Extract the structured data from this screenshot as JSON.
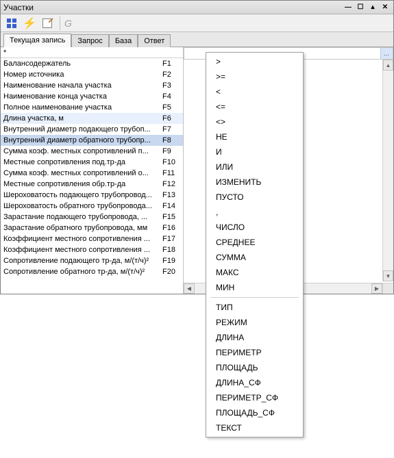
{
  "window": {
    "title": "Участки"
  },
  "toolbar": {
    "g_label": "G"
  },
  "tabs": {
    "items": [
      {
        "label": "Текущая запись"
      },
      {
        "label": "Запрос"
      },
      {
        "label": "База"
      },
      {
        "label": "Ответ"
      }
    ]
  },
  "left_header": {
    "star": "*"
  },
  "fields": [
    {
      "name": "Балансодержатель",
      "fld": "F1"
    },
    {
      "name": "Номер источника",
      "fld": "F2"
    },
    {
      "name": "Наименование начала участка",
      "fld": "F3"
    },
    {
      "name": "Наименование конца участка",
      "fld": "F4"
    },
    {
      "name": "Полное наименование участка",
      "fld": "F5"
    },
    {
      "name": "Длина участка, м",
      "fld": "F6"
    },
    {
      "name": "Внутренний диаметр подающего трубоп...",
      "fld": "F7"
    },
    {
      "name": "Внутренний диаметр обратного трубопр...",
      "fld": "F8"
    },
    {
      "name": "Сумма коэф. местных сопротивлений п...",
      "fld": "F9"
    },
    {
      "name": "Местные сопротивления под.тр-да",
      "fld": "F10"
    },
    {
      "name": "Сумма коэф. местных сопротивлений о...",
      "fld": "F11"
    },
    {
      "name": "Местные сопротивления обр.тр-да",
      "fld": "F12"
    },
    {
      "name": "Шероховатость подающего трубопровод...",
      "fld": "F13"
    },
    {
      "name": "Шероховатость обратного трубопровода...",
      "fld": "F14"
    },
    {
      "name": "Зарастание подающего трубопровода, ...",
      "fld": "F15"
    },
    {
      "name": "Зарастание обратного трубопровода, мм",
      "fld": "F16"
    },
    {
      "name": "Коэффициент местного сопротивления ...",
      "fld": "F17"
    },
    {
      "name": "Коэффициент местного сопротивления ...",
      "fld": "F18"
    },
    {
      "name": "Сопротивление подающего тр-да, м/(т/ч)²",
      "fld": "F19"
    },
    {
      "name": "Сопротивление обратного тр-да, м/(т/ч)²",
      "fld": "F20"
    }
  ],
  "input": {
    "value": ""
  },
  "menu": {
    "group1": [
      ">",
      ">=",
      "<",
      "<=",
      "<>",
      "НЕ",
      "И",
      "ИЛИ",
      "ИЗМЕНИТЬ",
      "ПУСТО",
      ",",
      "ЧИСЛО",
      "СРЕДНЕЕ",
      "СУММА",
      "МАКС",
      "МИН"
    ],
    "group2": [
      "ТИП",
      "РЕЖИМ",
      "ДЛИНА",
      "ПЕРИМЕТР",
      "ПЛОЩАДЬ",
      "ДЛИНА_СФ",
      "ПЕРИМЕТР_СФ",
      "ПЛОЩАДЬ_СФ",
      "ТЕКСТ"
    ]
  }
}
